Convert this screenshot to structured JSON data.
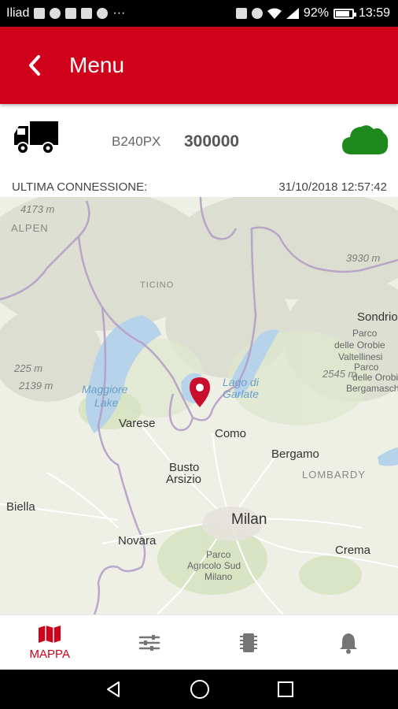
{
  "status_bar": {
    "carrier": "Iliad",
    "dots": "···",
    "battery": "92%",
    "time": "13:59"
  },
  "toolbar": {
    "title": "Menu"
  },
  "vehicle": {
    "plate": "B240PX",
    "km": "300000",
    "cloud_color": "#1e8a1e"
  },
  "connection": {
    "label": "ULTIMA CONNESSIONE:",
    "timestamp": "31/10/2018 12:57:42"
  },
  "map": {
    "labels": {
      "elev_4173": "4173 m",
      "alpen": "ALPEN",
      "elev_3930": "3930 m",
      "ticino": "TICINO",
      "sondrio": "Sondrio",
      "parco_orobie_1": "Parco",
      "parco_orobie_2": "delle Orobie",
      "parco_orobie_3": "Valtellinesi",
      "parco_orobie_b1": "Parco",
      "parco_orobie_b2": "delle Orobie",
      "parco_orobie_b3": "Bergamasche",
      "elev_2545": "2545 m",
      "elev_225": "225 m",
      "elev_2139": "2139 m",
      "maggiore_1": "Maggiore",
      "maggiore_2": "Lake",
      "lago_1": "Lago di",
      "lago_2": "Garlate",
      "varese": "Varese",
      "como": "Como",
      "bergamo": "Bergamo",
      "busto_1": "Busto",
      "busto_2": "Arsizio",
      "lombardy": "LOMBARDY",
      "biella": "Biella",
      "milan": "Milan",
      "novara": "Novara",
      "crema": "Crema",
      "parco_sud_1": "Parco",
      "parco_sud_2": "Agricolo Sud",
      "parco_sud_3": "Milano"
    },
    "pin_color": "#c8102e"
  },
  "bottom_nav": {
    "items": [
      {
        "label": "MAPPA",
        "icon": "map-icon",
        "active": true
      },
      {
        "label": "",
        "icon": "sliders-icon",
        "active": false
      },
      {
        "label": "",
        "icon": "chip-icon",
        "active": false
      },
      {
        "label": "",
        "icon": "bell-icon",
        "active": false
      }
    ]
  },
  "colors": {
    "primary": "#d0021b",
    "inactive_icon": "#757575"
  }
}
